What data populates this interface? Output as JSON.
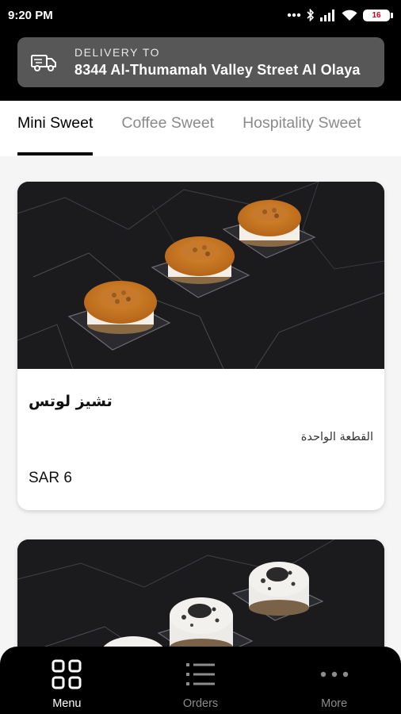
{
  "status_bar": {
    "time": "9:20 PM",
    "battery": "16"
  },
  "header": {
    "delivery_label": "DELIVERY TO",
    "delivery_address": "8344 Al-Thumamah Valley Street Al Olaya",
    "icon": "truck-icon"
  },
  "tabs": [
    {
      "label": "Mini Sweet",
      "active": true
    },
    {
      "label": "Coffee Sweet",
      "active": false
    },
    {
      "label": "Hospitality Sweet",
      "active": false
    }
  ],
  "products": [
    {
      "name": "تشيز لوتس",
      "description": "القطعة الواحدة",
      "price": "SAR 6"
    }
  ],
  "bottom_nav": [
    {
      "label": "Menu",
      "icon": "grid-icon",
      "active": true
    },
    {
      "label": "Orders",
      "icon": "list-icon",
      "active": false
    },
    {
      "label": "More",
      "icon": "more-dots-icon",
      "active": false
    }
  ],
  "colors": {
    "header_bg": "#000000",
    "delivery_box_bg": "#575757",
    "tab_active": "#000000",
    "tab_inactive": "#8a8a8a",
    "battery_text": "#d0021b"
  }
}
